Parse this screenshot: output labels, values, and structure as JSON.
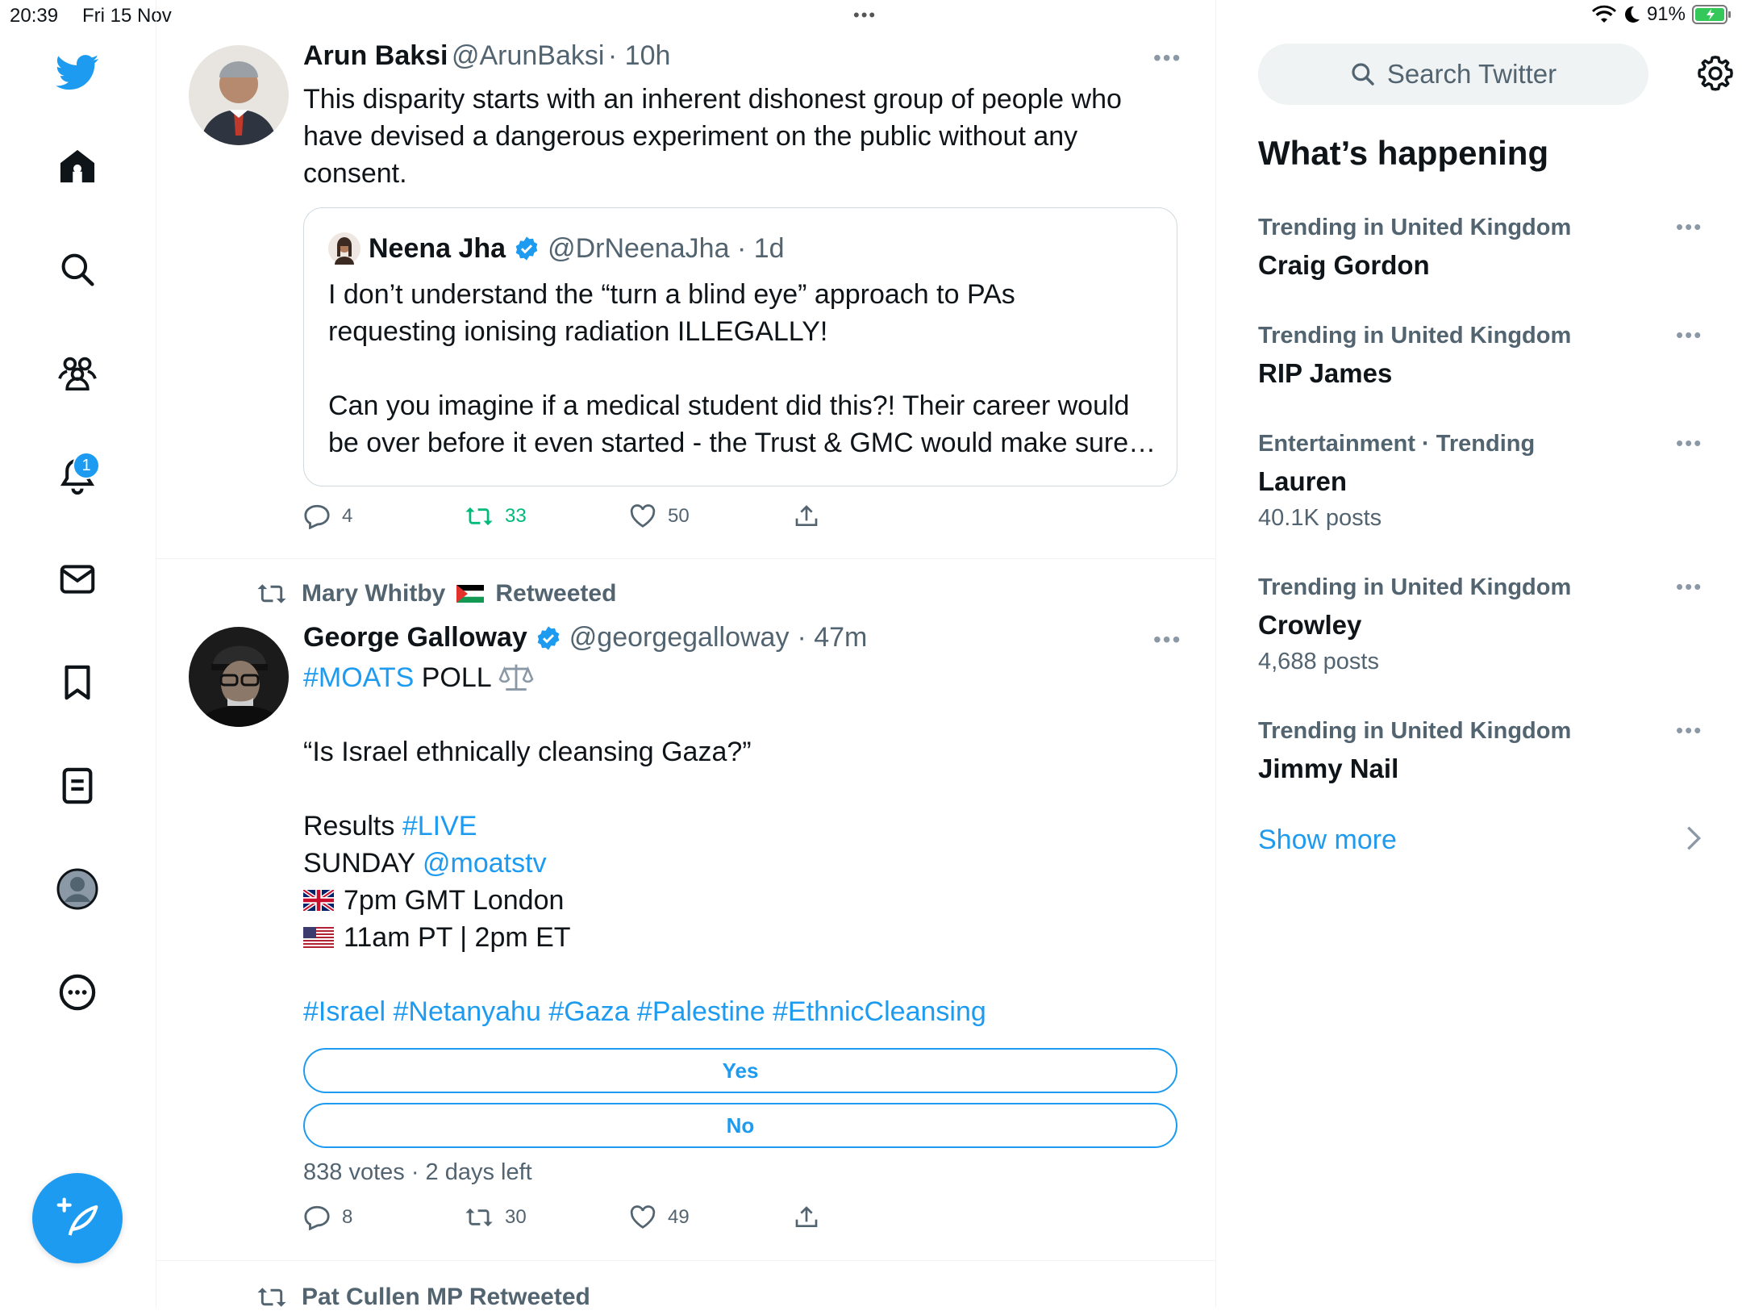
{
  "status_bar": {
    "time": "20:39",
    "date": "Fri 15 Nov",
    "battery": "91%"
  },
  "nav": {
    "notifications_badge": "1",
    "icons": [
      "twitter-logo-icon",
      "home-icon",
      "search-icon",
      "communities-icon",
      "bell-icon",
      "mail-icon",
      "bookmark-icon",
      "lists-icon",
      "profile-icon",
      "more-icon",
      "compose-icon"
    ]
  },
  "tweets": [
    {
      "name": "Arun Baksi",
      "handle": "@ArunBaksi",
      "time": "· 10h",
      "text_lines": [
        "This disparity starts with an inherent dishonest group of people who",
        "have devised a dangerous experiment on the public without any",
        "consent."
      ],
      "quote": {
        "name": "Neena Jha",
        "handle": "@DrNeenaJha · 1d",
        "lines": [
          "I don’t understand the “turn a blind eye” approach to PAs",
          "requesting ionising radiation ILLEGALLY!",
          "",
          "Can you imagine if a medical student did this?! Their career would",
          "be over before it even started - the Trust & GMC would make sure…"
        ]
      },
      "replies": "4",
      "retweets": "33",
      "likes": "50"
    },
    {
      "retweeted_by": "Mary Whitby",
      "retweeted_suffix": "Retweeted",
      "name": "George Galloway",
      "handle": "@georgegalloway",
      "time": "· 47m",
      "hashtag_moats": "#MOATS",
      "poll_word": " POLL ",
      "question": "“Is Israel ethnically cleansing Gaza?”",
      "results_label": "Results ",
      "results_tag": "#LIVE",
      "sunday_label": "SUNDAY ",
      "sunday_handle": "@moatstv",
      "time_uk": "7pm GMT London",
      "time_us": "11am PT | 2pm ET",
      "hashtags": "#Israel #Netanyahu #Gaza #Palestine #EthnicCleansing",
      "poll_options": [
        "Yes",
        "No"
      ],
      "poll_meta": "838 votes · 2 days left",
      "replies": "8",
      "retweets": "30",
      "likes": "49"
    },
    {
      "retweeted_by": "Pat Cullen MP Retweeted"
    }
  ],
  "sidebar": {
    "search_placeholder": "Search Twitter",
    "heading": "What’s happening",
    "trends": [
      {
        "category": "Trending in United Kingdom",
        "name": "Craig Gordon",
        "count": ""
      },
      {
        "category": "Trending in United Kingdom",
        "name": "RIP James",
        "count": ""
      },
      {
        "category": "Entertainment · Trending",
        "name": "Lauren",
        "count": "40.1K posts"
      },
      {
        "category": "Trending in United Kingdom",
        "name": "Crowley",
        "count": "4,688 posts"
      },
      {
        "category": "Trending in United Kingdom",
        "name": "Jimmy Nail",
        "count": ""
      }
    ],
    "show_more": "Show more"
  },
  "colors": {
    "accent": "#1d9bf0",
    "retweet_green": "#00ba7c",
    "muted": "#536471"
  }
}
